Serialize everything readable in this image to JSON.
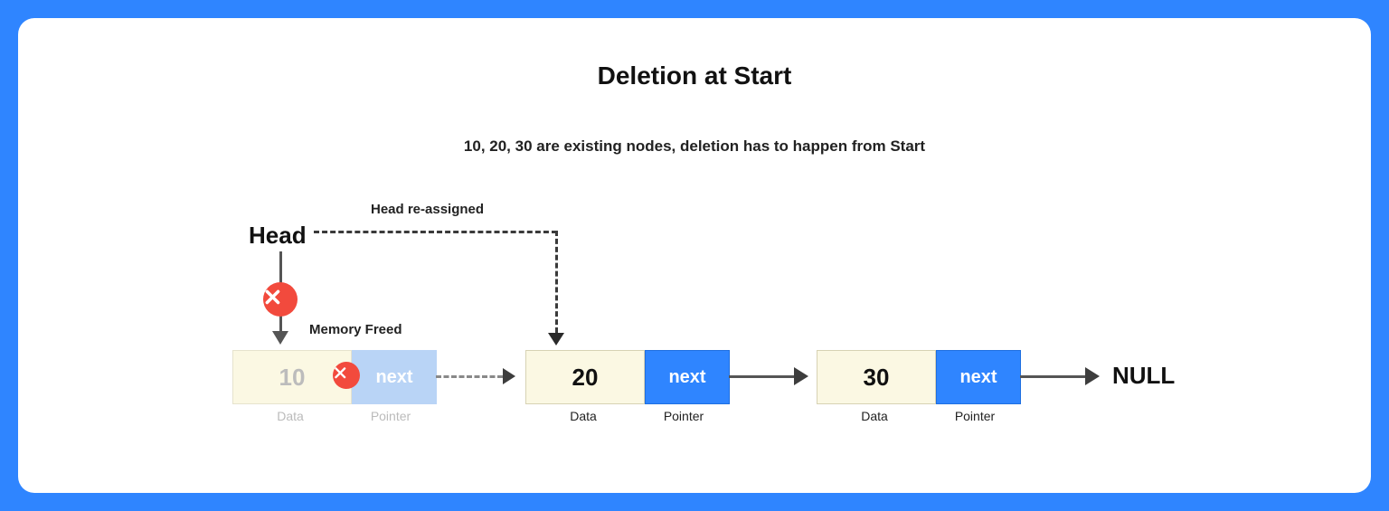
{
  "title": "Deletion at Start",
  "subtitle": "10, 20, 30 are existing nodes, deletion has to happen from Start",
  "labels": {
    "head": "Head",
    "head_reassigned": "Head re-assigned",
    "memory_freed": "Memory Freed",
    "null": "NULL",
    "data_col": "Data",
    "pointer_col": "Pointer"
  },
  "nodes": [
    {
      "value": "10",
      "next_label": "next",
      "state": "freed"
    },
    {
      "value": "20",
      "next_label": "next",
      "state": "active"
    },
    {
      "value": "30",
      "next_label": "next",
      "state": "active"
    }
  ],
  "icons": {
    "delete": "close-icon"
  },
  "colors": {
    "accent": "#2f85ff",
    "node_bg": "#fbf8e3",
    "delete": "#f24a3d"
  }
}
